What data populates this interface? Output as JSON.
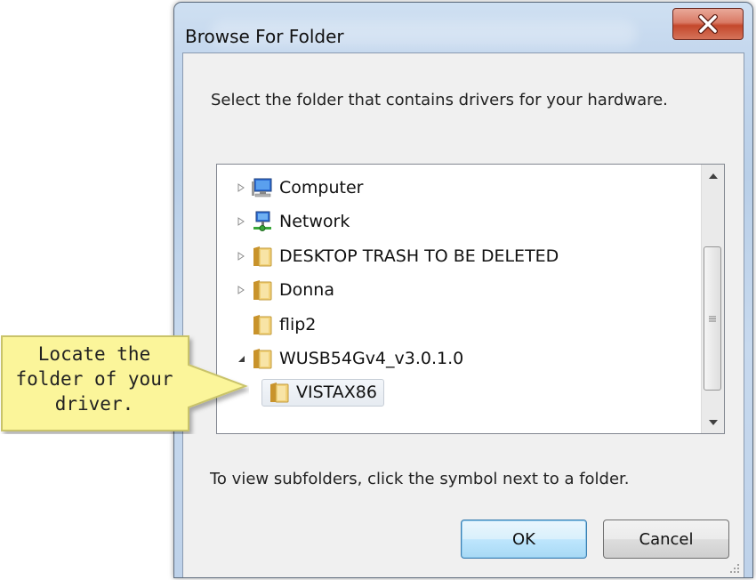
{
  "dialog": {
    "title": "Browse For Folder",
    "instruction": "Select the folder that contains drivers for your hardware.",
    "hint": "To view subfolders, click the symbol next to a folder.",
    "ok_label": "OK",
    "cancel_label": "Cancel"
  },
  "tree": {
    "items": [
      {
        "label": "Computer",
        "icon": "computer-icon",
        "expander": "collapsed"
      },
      {
        "label": "Network",
        "icon": "network-icon",
        "expander": "collapsed"
      },
      {
        "label": "DESKTOP TRASH TO BE DELETED",
        "icon": "folder-icon",
        "expander": "collapsed"
      },
      {
        "label": "Donna",
        "icon": "folder-icon",
        "expander": "collapsed"
      },
      {
        "label": "flip2",
        "icon": "folder-icon",
        "expander": "none"
      },
      {
        "label": "WUSB54Gv4_v3.0.1.0",
        "icon": "folder-icon",
        "expander": "expanded"
      },
      {
        "label": "VISTAX86",
        "icon": "folder-icon",
        "expander": "none",
        "selected": true
      }
    ]
  },
  "callout": {
    "text_line1": "Locate the",
    "text_line2": "folder of your",
    "text_line3": "driver."
  },
  "colors": {
    "callout_fill": "#fbf59a",
    "folder": "#e7c25d",
    "close_button": "#c4482c"
  }
}
